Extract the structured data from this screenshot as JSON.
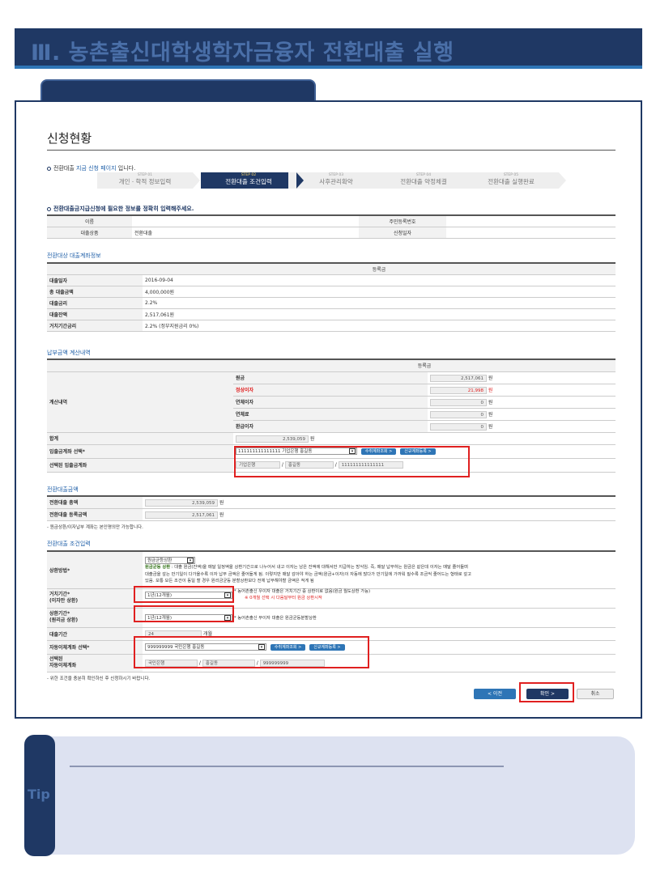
{
  "banner": {
    "title": "Ⅲ. 농촌출신대학생학자금융자 전환대출 실행"
  },
  "page": {
    "title": "신청현황",
    "note1_prefix": "전환대출 ",
    "note1_em": "지금 신청 페이지",
    "note1_suffix": " 입니다.",
    "note2": "전환대출금지급신청에 필요한 정보를 정확히 입력해주세요."
  },
  "steps": [
    {
      "no": "STEP 01",
      "label": "개인ㆍ학적 정보입력",
      "active": false
    },
    {
      "no": "STEP 02",
      "label": "전환대출 조건입력",
      "active": true
    },
    {
      "no": "STEP 03",
      "label": "사후관리확약",
      "active": false
    },
    {
      "no": "STEP 04",
      "label": "전환대출 약정체결",
      "active": false
    },
    {
      "no": "STEP 05",
      "label": "전환대출 실행완료",
      "active": false
    }
  ],
  "info": {
    "name_label": "이름",
    "name_value": "",
    "rrn_label": "주민등록번호",
    "rrn_value": "",
    "product_label": "대출상품",
    "product_value": "전환대출",
    "date_label": "신청일자",
    "date_value": ""
  },
  "loan": {
    "section": "전환대상 대출계좌정보",
    "col": "등록금",
    "rows": [
      {
        "label": "대출일자",
        "value": "2016-09-04"
      },
      {
        "label": "총 대출금액",
        "value": "4,000,000원"
      },
      {
        "label": "대출금리",
        "value": "2.2%"
      },
      {
        "label": "대출잔액",
        "value": "2,517,061원"
      },
      {
        "label": "거치기간금리",
        "value": "2.2% (정부지원금리 0%)"
      }
    ]
  },
  "pay": {
    "section": "납부금액 계산내역",
    "col": "등록금",
    "calc_label": "계산내역",
    "items": [
      {
        "label": "원금",
        "value": "2,517,061",
        "unit": "원",
        "red": false
      },
      {
        "label": "정상이자",
        "value": "21,998",
        "unit": "원",
        "red": true
      },
      {
        "label": "연체이자",
        "value": "0",
        "unit": "원",
        "red": false
      },
      {
        "label": "연체료",
        "value": "0",
        "unit": "원",
        "red": false
      },
      {
        "label": "환급이자",
        "value": "0",
        "unit": "원",
        "red": false
      }
    ],
    "total_label": "합계",
    "total_value": "2,539,059",
    "total_unit": "원",
    "account_label": "입출금계좌 선택*",
    "account_select": "111111111111111 기업은행 홍길동",
    "btn_receive": "수취계좌조회 >",
    "btn_new": "신규계좌등록 >",
    "selected_label": "선택된 입출금계좌",
    "bank": "기업은행",
    "holder": "홍길동",
    "acct_no": "111111111111111"
  },
  "convert": {
    "section": "전환대출금액",
    "total_label": "전환대출 총액",
    "total_value": "2,539,059",
    "total_unit": "원",
    "tuition_label": "전환대출 등록금액",
    "tuition_value": "2,517,061",
    "tuition_unit": "원",
    "footnote": "- 원금상환/이자납부 계좌는 본인명의만 가능합니다."
  },
  "cond": {
    "section": "전환대출 조건입력",
    "method_label": "상환방법*",
    "method_select": "원금균등상환",
    "method_bold": "원금균등 상환",
    "method_desc1": " : 대출 원금(잔액)을 매달 일정액을 상환기간으로 나누어서 내고 이자는 남은 잔액에 대해서만 지급하는 방식임. 즉, 매달 납부하는 원금은 같은데 이자는 매달 줄어들며",
    "method_desc2": "대출금을 갚는 만기일이 다가올수록 이자 납부 금액은 줄어들게 됨. 이렇지만 매달 갚아야 하는 금액(원금+이자)이 자동에 많다가 만기일에 가까워 질수록 조금씩 줄어드는 형태로 갚고",
    "method_desc3": "있음. 보통 모든 조건이 동일 할 경우 원리금균등 분할상환보다 전체 납부해야할 금액은 적게 됨",
    "defer_label": "거치기간*",
    "defer_sub": "(이자만 상환)",
    "defer_select": "1년(12개월)",
    "defer_note": "* 농어촌출신 우이자 대출은 거치기간 중 상환이로 없음(원금 월도상환 가능)",
    "defer_note_red": "※ 0개월 선택 시 다음달부터 원금 상환시작",
    "repay_label": "상환기간*",
    "repay_sub": "(원리금 상환)",
    "repay_select": "1년(12개월)",
    "repay_note": "* 농어촌출신 무이자 대출은 원금균등분할상환",
    "period_label": "대출기간",
    "period_value": "24",
    "period_unit": "개월",
    "auto_label": "자동이체계좌 선택*",
    "auto_select": "999999999 국민은행 홍길동",
    "auto_btn1": "수취계좌조회 >",
    "auto_btn2": "신규계좌등록 >",
    "auto_sel_label1": "선택된",
    "auto_sel_label2": "자동이체계좌",
    "auto_bank": "국민은행",
    "auto_holder": "홍길동",
    "auto_no": "999999999",
    "footnote": "- 위한 조건을 충분히 확인하신 후 신청하시기 바랍니다."
  },
  "buttons": {
    "prev": "< 이전",
    "ok": "확인 >",
    "cancel": "취소"
  },
  "tip": {
    "label": "Tip"
  }
}
